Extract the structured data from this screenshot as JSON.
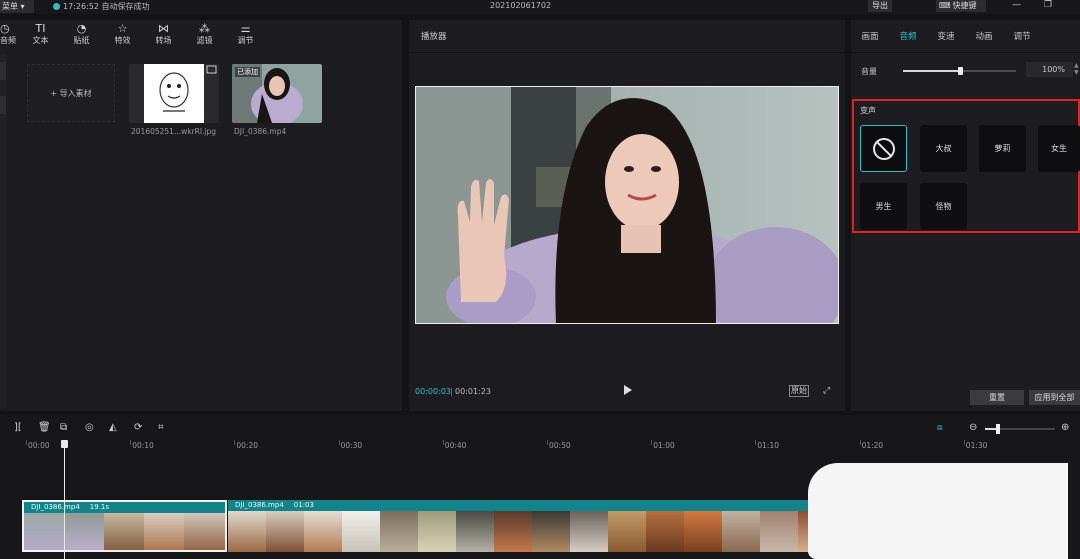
{
  "topbar": {
    "menu": "菜单",
    "menu_caret": "▾",
    "autosave": "17:26:52 自动保存成功",
    "doc_title": "202102061702",
    "export": "导出",
    "shortcut": "快捷键",
    "minimize": "—",
    "restore": "❐"
  },
  "media_toolbar": [
    {
      "label": "音频",
      "icon": "audio-icon"
    },
    {
      "label": "文本",
      "icon": "text-icon"
    },
    {
      "label": "贴纸",
      "icon": "sticker-icon"
    },
    {
      "label": "特效",
      "icon": "effects-icon"
    },
    {
      "label": "转场",
      "icon": "transition-icon"
    },
    {
      "label": "滤镜",
      "icon": "filter-icon"
    },
    {
      "label": "调节",
      "icon": "adjust-icon"
    }
  ],
  "media": {
    "import_label": "导入素材",
    "items": [
      {
        "name": "201605251...wkrRI.jpg",
        "badge": ""
      },
      {
        "name": "DJI_0386.mp4",
        "badge": "已添加"
      }
    ]
  },
  "player": {
    "title": "播放器",
    "current_time": "00:00:03",
    "separator": "|",
    "duration": "00:01:23",
    "ratio_label": "原始"
  },
  "inspector": {
    "tabs": [
      {
        "label": "画面",
        "active": false
      },
      {
        "label": "音频",
        "active": true
      },
      {
        "label": "变速",
        "active": false
      },
      {
        "label": "动画",
        "active": false
      },
      {
        "label": "调节",
        "active": false
      }
    ],
    "volume_label": "音量",
    "volume_value": "100%",
    "volume_level": 0.5,
    "voice_change_title": "变声",
    "voices": [
      {
        "label": "",
        "icon": "none-icon",
        "selected": true
      },
      {
        "label": "大叔",
        "selected": false
      },
      {
        "label": "萝莉",
        "selected": false
      },
      {
        "label": "女生",
        "selected": false
      },
      {
        "label": "男生",
        "selected": false
      },
      {
        "label": "怪物",
        "selected": false
      }
    ],
    "reset": "重置",
    "apply_all": "应用到全部"
  },
  "timeline": {
    "ruler": [
      "00:00",
      "00:10",
      "00:20",
      "00:30",
      "00:40",
      "00:50",
      "01:00",
      "01:10",
      "01:20",
      "01:30"
    ],
    "zoom_level": 0.18,
    "clips": [
      {
        "name": "DJI_0386.mp4",
        "duration": "19.1s"
      },
      {
        "name": "DJI_0386.mp4",
        "duration": "01:03"
      }
    ]
  },
  "colors": {
    "accent": "#26c1c9",
    "clip": "#14838a",
    "highlight": "#e02424"
  }
}
